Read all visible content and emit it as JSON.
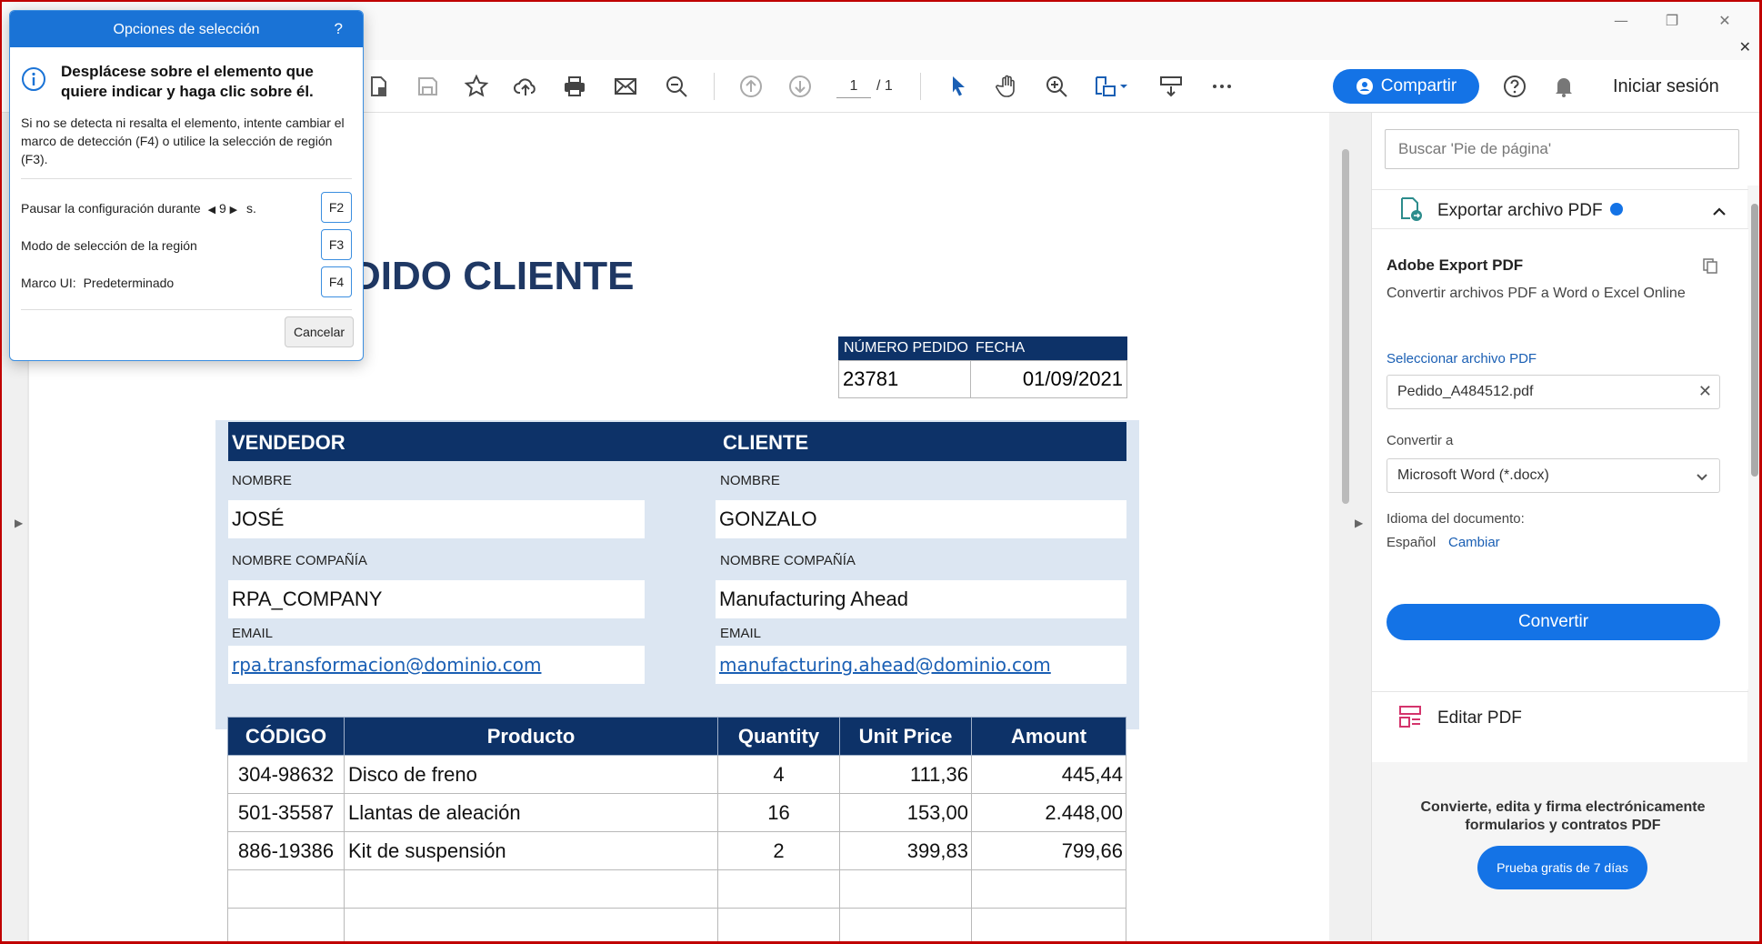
{
  "window": {
    "minimize": "—",
    "restore": "❐",
    "close": "✕",
    "tab_close": "✕"
  },
  "toolbar": {
    "page_current": "1",
    "page_total": "/ 1",
    "share_label": "Compartir",
    "signin_label": "Iniciar sesión"
  },
  "document": {
    "title": "DIDO CLIENTE",
    "order_header": {
      "number_label": "NÚMERO PEDIDO",
      "date_label": "FECHA"
    },
    "order_values": {
      "number": "23781",
      "date": "01/09/2021"
    },
    "seller": {
      "header": "VENDEDOR",
      "name_label": "NOMBRE",
      "name": "JOSÉ",
      "company_label": "NOMBRE COMPAÑÍA",
      "company": "RPA_COMPANY",
      "email_label": "EMAIL",
      "email": "rpa.transformacion@dominio.com"
    },
    "client": {
      "header": "CLIENTE",
      "name_label": "NOMBRE",
      "name": "GONZALO",
      "company_label": "NOMBRE COMPAÑÍA",
      "company": "Manufacturing Ahead",
      "email_label": "EMAIL",
      "email": "manufacturing.ahead@dominio.com"
    },
    "items_columns": [
      "CÓDIGO",
      "Producto",
      "Quantity",
      "Unit Price",
      "Amount"
    ],
    "items": [
      [
        "304-98632",
        "Disco de freno",
        "4",
        "111,36",
        "445,44"
      ],
      [
        "501-35587",
        "Llantas de aleación",
        "16",
        "153,00",
        "2.448,00"
      ],
      [
        "886-19386",
        "Kit de suspensión",
        "2",
        "399,83",
        "799,66"
      ],
      [
        "",
        "",
        "",
        "",
        ""
      ],
      [
        "",
        "",
        "",
        "",
        ""
      ]
    ]
  },
  "right_panel": {
    "search_placeholder": "Buscar 'Pie de página'",
    "export_title": "Exportar archivo PDF",
    "export_heading": "Adobe Export PDF",
    "export_desc": "Convertir archivos PDF a Word o Excel Online",
    "select_file_link": "Seleccionar archivo PDF",
    "file_name": "Pedido_A484512.pdf",
    "convert_to_label": "Convertir a",
    "convert_to_value": "Microsoft Word (*.docx)",
    "doc_language_label": "Idioma del documento:",
    "doc_language_value": "Español",
    "change_link": "Cambiar",
    "convert_button": "Convertir",
    "edit_pdf": "Editar PDF",
    "promo_text": "Convierte, edita y firma electrónicamente formularios y contratos PDF",
    "trial_button": "Prueba gratis de 7 días"
  },
  "dialog": {
    "title": "Opciones de selección",
    "help": "?",
    "main_text": "Desplácese sobre el elemento que quiere indicar y haga clic sobre él.",
    "sub_text": "Si no se detecta ni resalta el elemento, intente cambiar el marco de detección (F4) o utilice la selección de región (F3).",
    "pause_label_before": "Pausar la configuración durante",
    "pause_value": "9",
    "pause_label_after": "s.",
    "pause_key": "F2",
    "region_label": "Modo de selección de la región",
    "region_key": "F3",
    "frame_label": "Marco UI:",
    "frame_value": "Predeterminado",
    "frame_key": "F4",
    "cancel": "Cancelar"
  },
  "colors": {
    "accent": "#1473e6",
    "doc_header": "#0d3268",
    "doc_title": "#1f3864",
    "frame_border": "#c00000"
  }
}
